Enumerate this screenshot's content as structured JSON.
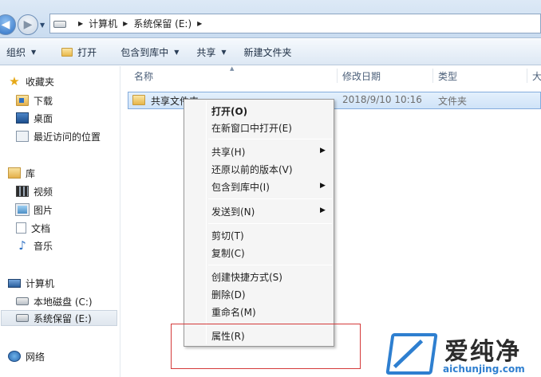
{
  "address": {
    "crumbs": [
      "计算机",
      "系统保留 (E:)"
    ]
  },
  "toolbar": {
    "organize": "组织",
    "open": "打开",
    "include_library": "包含到库中",
    "share": "共享",
    "new_folder": "新建文件夹"
  },
  "nav": {
    "favorites": "收藏夹",
    "downloads": "下载",
    "desktop": "桌面",
    "recent": "最近访问的位置",
    "libraries": "库",
    "videos": "视频",
    "pictures": "图片",
    "documents": "文档",
    "music": "音乐",
    "computer": "计算机",
    "local_disk": "本地磁盘 (C:)",
    "system_reserved": "系统保留 (E:)",
    "network": "网络"
  },
  "columns": {
    "name": "名称",
    "date": "修改日期",
    "type": "类型",
    "size": "大"
  },
  "files": [
    {
      "name": "共享文件夹",
      "date": "2018/9/10 10:16",
      "type": "文件夹"
    }
  ],
  "context_menu": {
    "open": "打开(O)",
    "open_new_window": "在新窗口中打开(E)",
    "share": "共享(H)",
    "restore": "还原以前的版本(V)",
    "include_library": "包含到库中(I)",
    "send_to": "发送到(N)",
    "cut": "剪切(T)",
    "copy": "复制(C)",
    "create_shortcut": "创建快捷方式(S)",
    "delete": "删除(D)",
    "rename": "重命名(M)",
    "properties": "属性(R)"
  },
  "watermark": {
    "title": "爱纯净",
    "url": "aichunjing.com"
  },
  "colors": {
    "accent": "#2e7fd0",
    "annotation": "#d43a3a",
    "selection": "#cfe3f8"
  }
}
